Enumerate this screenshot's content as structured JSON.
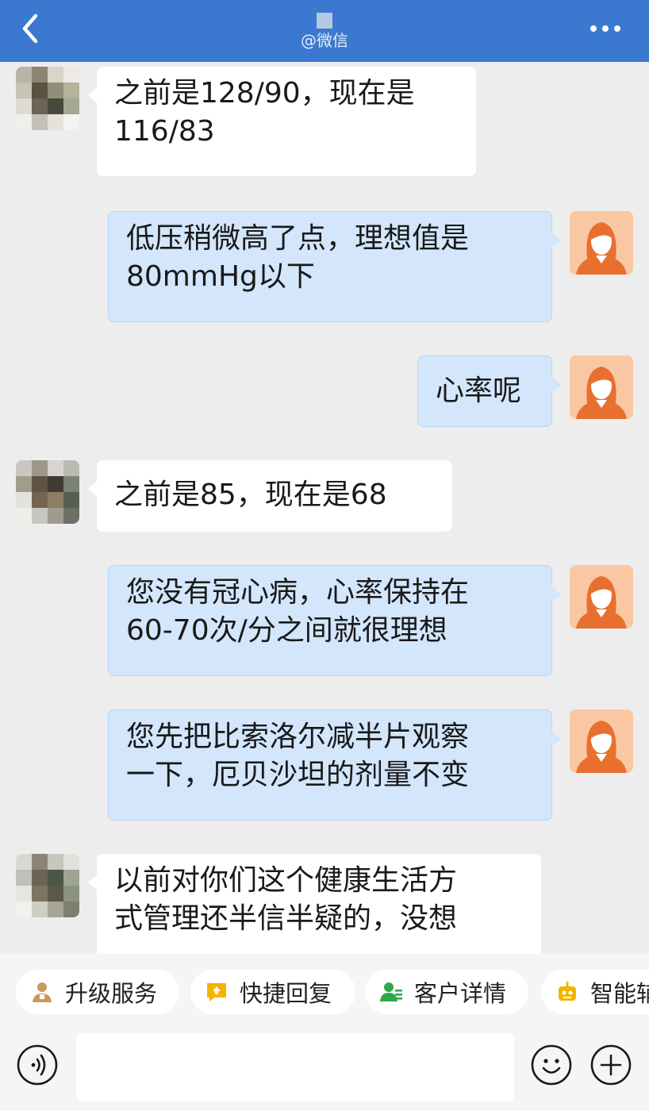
{
  "header": {
    "subtitle": "@微信"
  },
  "messages": [
    {
      "side": "left",
      "lines": [
        "之前是128/90，现在是",
        "116/83"
      ]
    },
    {
      "side": "right",
      "lines": [
        "低压稍微高了点，理想值是",
        "80mmHg以下"
      ]
    },
    {
      "side": "right",
      "lines": [
        "心率呢"
      ]
    },
    {
      "side": "left",
      "lines": [
        "之前是85，现在是68"
      ]
    },
    {
      "side": "right",
      "lines": [
        "您没有冠心病，心率保持在",
        "60-70次/分之间就很理想"
      ]
    },
    {
      "side": "right",
      "lines": [
        "您先把比索洛尔减半片观察",
        "一下，厄贝沙坦的剂量不变"
      ]
    },
    {
      "side": "left",
      "lines": [
        "以前对你们这个健康生活方",
        "式管理还半信半疑的，没想"
      ]
    }
  ],
  "quick_actions": [
    {
      "label": "升级服务",
      "icon": "person-badge-icon",
      "color": "#c89a5a"
    },
    {
      "label": "快捷回复",
      "icon": "quick-reply-icon",
      "color": "#f5b400"
    },
    {
      "label": "客户详情",
      "icon": "customer-icon",
      "color": "#2ea84c"
    },
    {
      "label": "智能辅",
      "icon": "robot-icon",
      "color": "#f5b400"
    }
  ],
  "input": {
    "placeholder": ""
  },
  "colors": {
    "header_bg": "#3b78cf",
    "right_bubble": "#d3e6fb",
    "left_bubble": "#ffffff",
    "doctor_avatar_bg": "#f9c8a3",
    "doctor_hair": "#e8702f"
  }
}
